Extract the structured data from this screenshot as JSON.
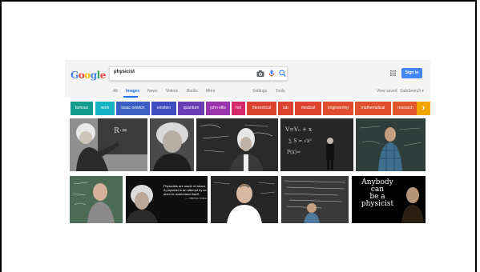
{
  "search": {
    "query": "physicist",
    "signin_label": "Sign in"
  },
  "logo_letters": [
    "G",
    "o",
    "o",
    "g",
    "l",
    "e"
  ],
  "tabs": [
    "All",
    "Images",
    "News",
    "Videos",
    "Books",
    "More"
  ],
  "active_tab": "Images",
  "settings_label": "Settings",
  "tools_label": "Tools",
  "view_saved_label": "View saved",
  "safesearch_label": "SafeSearch ▾",
  "chips": [
    {
      "label": "famous",
      "color": "#139c8e"
    },
    {
      "label": "work",
      "color": "#15b3c4"
    },
    {
      "label": "isaac newton",
      "color": "#3b5fc5"
    },
    {
      "label": "einstein",
      "color": "#3f4dc0"
    },
    {
      "label": "quantum",
      "color": "#6b3db5"
    },
    {
      "label": "john ellis",
      "color": "#9a33ae"
    },
    {
      "label": "hot",
      "color": "#d42a6b"
    },
    {
      "label": "theoretical",
      "color": "#d9432f"
    },
    {
      "label": "lab",
      "color": "#db4230"
    },
    {
      "label": "medical",
      "color": "#dd4430"
    },
    {
      "label": "engineering",
      "color": "#df4c2e"
    },
    {
      "label": "mathematical",
      "color": "#e0502e"
    },
    {
      "label": "research",
      "color": "#e3552d"
    }
  ],
  "chip_arrow": "›",
  "image_text": {
    "quote_lines": [
      "Physicists are made of atoms.",
      "A physicist is an attempt by an",
      "atom to understand itself.",
      "— Michio Kaku"
    ],
    "poster_lines": [
      "Anybody",
      "can",
      "be a",
      "physicist"
    ]
  }
}
